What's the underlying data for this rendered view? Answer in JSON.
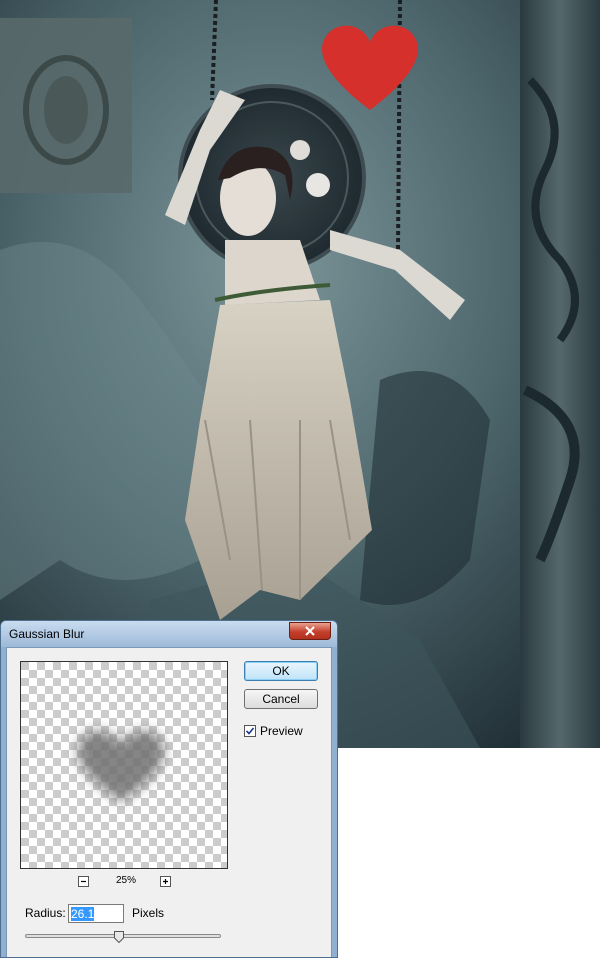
{
  "dialog": {
    "title": "Gaussian Blur",
    "close_icon": "close-icon",
    "ok_label": "OK",
    "cancel_label": "Cancel",
    "preview_checkbox": {
      "label": "Preview",
      "checked": true
    },
    "zoom": {
      "value": "25%",
      "minus_icon": "minus-icon",
      "plus_icon": "plus-icon"
    },
    "radius": {
      "label": "Radius:",
      "value": "26.1",
      "units": "Pixels",
      "slider_fraction": 0.48
    }
  },
  "colors": {
    "accent": "#3399ff",
    "heart": "#d6302c",
    "dialog_frame": "#8fb0d0",
    "close_button": "#c4402c"
  }
}
